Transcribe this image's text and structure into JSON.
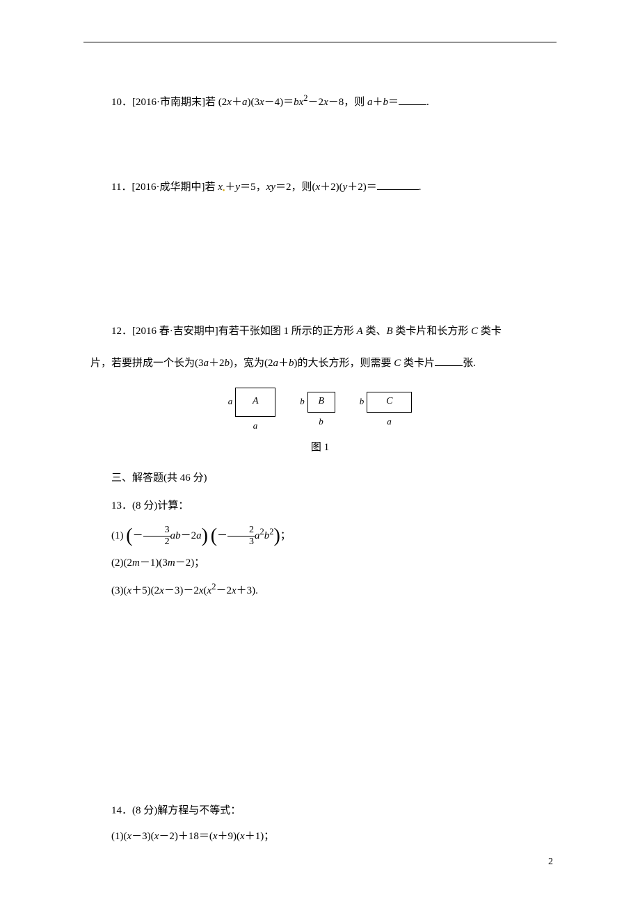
{
  "problems": {
    "p10": {
      "number": "10．",
      "source": "[2016·市南期末]",
      "text_before": "若 (2",
      "var_x1": "x",
      "text_mid1": "＋",
      "var_a1": "a",
      "text_mid2": ")(3",
      "var_x2": "x",
      "text_mid3": "－4)＝",
      "var_b1": "b",
      "var_x3": "x",
      "sup1": "2",
      "text_mid4": "－2",
      "var_x4": "x",
      "text_mid5": "－8，则 ",
      "var_a2": "a",
      "text_mid6": "＋",
      "var_b2": "b",
      "text_after": "＝",
      "period": "."
    },
    "p11": {
      "number": "11．",
      "source": "[2016·成华期中]",
      "text_before": "若 ",
      "var_x1": "x",
      "plus1": "＋",
      "var_y1": "y",
      "eq1": "＝5，",
      "var_x2": "x",
      "var_y2": "y",
      "eq2": "＝2，则(",
      "var_x3": "x",
      "mid1": "＋2)(",
      "var_y3": "y",
      "mid2": "＋2)＝",
      "period": "."
    },
    "p12": {
      "number": "12．",
      "source": "[2016 春·吉安期中]",
      "text_line1a": "有若干张如图 1 所示的正方形 ",
      "var_A1": "A",
      "text_line1b": " 类、",
      "var_B1": "B",
      "text_line1c": " 类卡片和长方形 ",
      "var_C1": "C",
      "text_line1d": " 类卡",
      "text_line2a": "片，若要拼成一个长为(3",
      "var_a1": "a",
      "text_line2b": "＋2",
      "var_b1": "b",
      "text_line2c": ")，宽为(2",
      "var_a2": "a",
      "text_line2d": "＋",
      "var_b2": "b",
      "text_line2e": ")的大长方形，则需要 ",
      "var_C2": "C",
      "text_line2f": " 类卡片",
      "text_line2g": "张."
    },
    "figure": {
      "label_A": "A",
      "label_B": "B",
      "label_C": "C",
      "side_a": "a",
      "side_b": "b",
      "caption": "图 1"
    },
    "section3": "三、解答题(共 46 分)",
    "p13": {
      "number": "13．",
      "points": "(8 分)",
      "title": "计算：",
      "sub1_label": "(1)",
      "sub1_frac1_num": "3",
      "sub1_frac1_den": "2",
      "sub1_ab": "ab",
      "sub1_minus": "－2",
      "sub1_a": "a",
      "sub1_frac2_num": "2",
      "sub1_frac2_den": "3",
      "sub1_a2": "a",
      "sub1_sup2": "2",
      "sub1_b2": "b",
      "sub1_supb": "2",
      "sub1_semi": "；",
      "sub2": "(2)(2",
      "sub2_m1": "m",
      "sub2_mid1": "－1)(3",
      "sub2_m2": "m",
      "sub2_mid2": "－2)；",
      "sub3": "(3)(",
      "sub3_x1": "x",
      "sub3_mid1": "＋5)(2",
      "sub3_x2": "x",
      "sub3_mid2": "－3)－2",
      "sub3_x3": "x",
      "sub3_mid3": "(",
      "sub3_x4": "x",
      "sub3_sup": "2",
      "sub3_mid4": "－2",
      "sub3_x5": "x",
      "sub3_mid5": "＋3)."
    },
    "p14": {
      "number": "14．",
      "points": "(8 分)",
      "title": "解方程与不等式：",
      "sub1": "(1)(",
      "sub1_x1": "x",
      "sub1_mid1": "－3)(",
      "sub1_x2": "x",
      "sub1_mid2": "－2)＋18＝(",
      "sub1_x3": "x",
      "sub1_mid3": "＋9)(",
      "sub1_x4": "x",
      "sub1_mid4": "＋1)；"
    }
  },
  "page_number": "2"
}
